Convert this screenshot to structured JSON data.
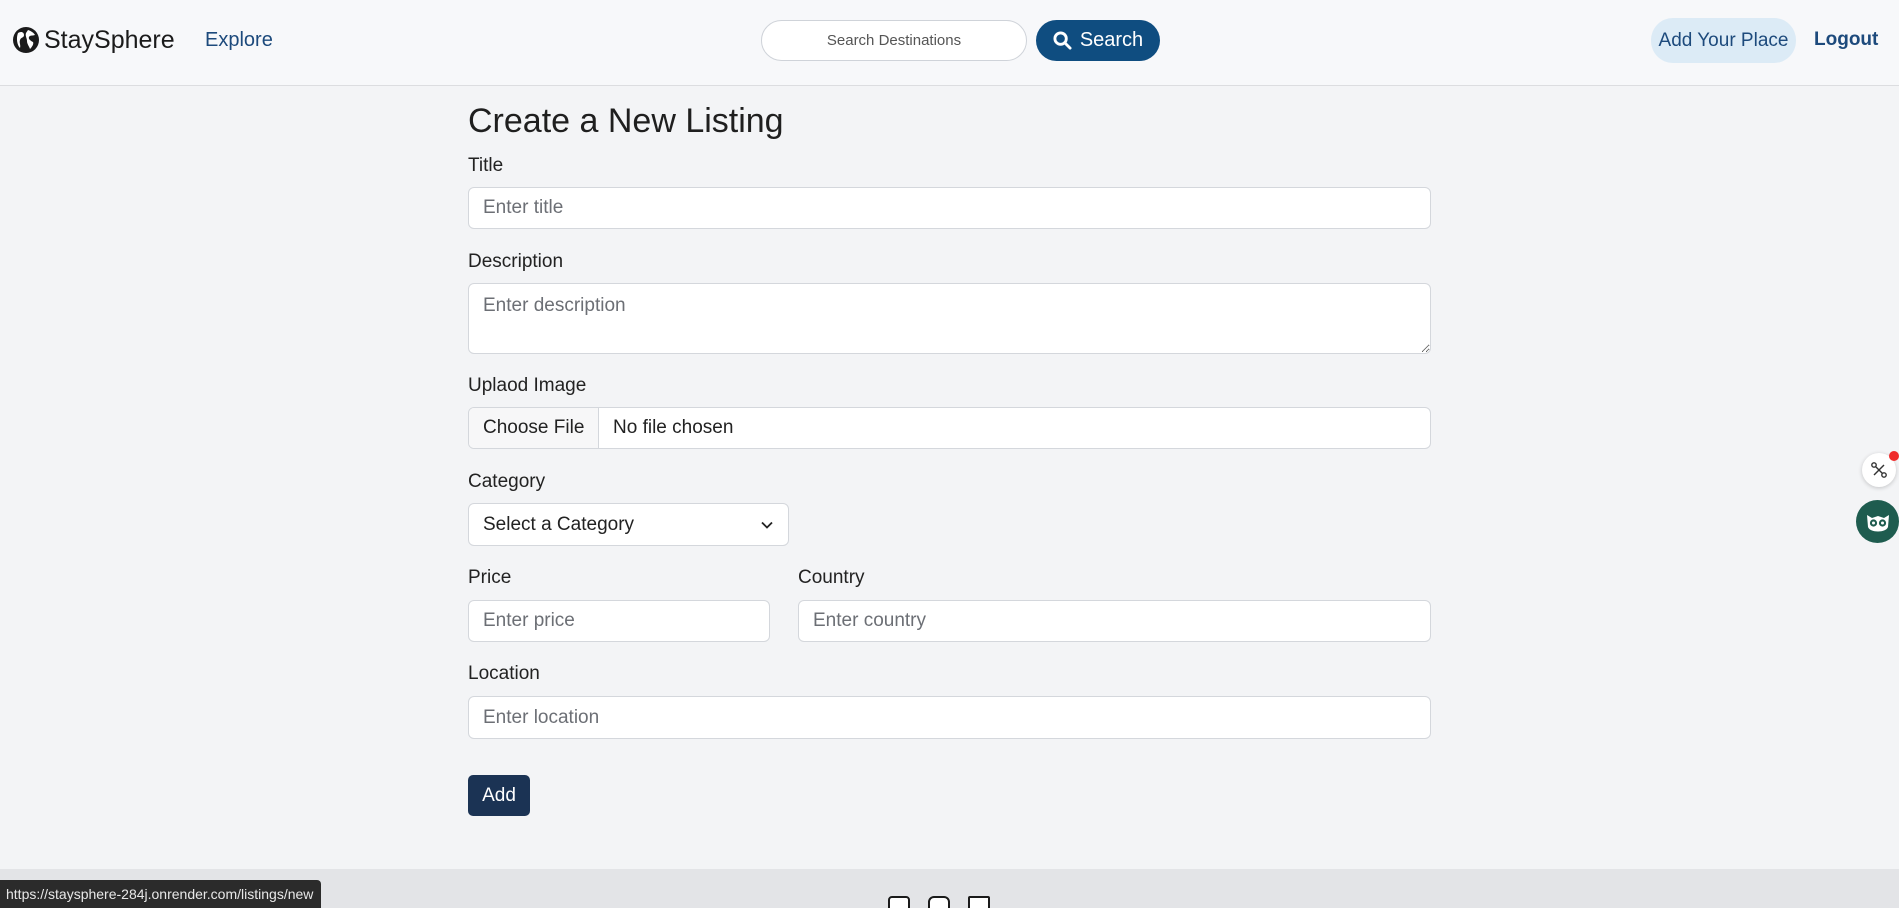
{
  "navbar": {
    "brand_name": "StaySphere",
    "brand_icon": "globe-icon",
    "explore_label": "Explore",
    "search_placeholder": "Search Destinations",
    "search_button_label": "Search",
    "search_icon": "search-icon",
    "add_place_label": "Add Your Place",
    "logout_label": "Logout"
  },
  "form": {
    "title": "Create a New Listing",
    "title_label": "Title",
    "title_placeholder": "Enter title",
    "description_label": "Description",
    "description_placeholder": "Enter description",
    "image_label": "Uplaod Image",
    "file_button_label": "Choose File",
    "file_status": "No file chosen",
    "category_label": "Category",
    "category_selected": "Select a Category",
    "price_label": "Price",
    "price_placeholder": "Enter price",
    "country_label": "Country",
    "country_placeholder": "Enter country",
    "location_label": "Location",
    "location_placeholder": "Enter location",
    "submit_label": "Add"
  },
  "footer": {
    "social_icons": [
      "facebook-icon",
      "instagram-icon",
      "x-icon"
    ]
  },
  "status_bar": {
    "url": "https://staysphere-284j.onrender.com/listings/new"
  },
  "floating_widgets": {
    "share_icon": "share-icon",
    "assistant_icon": "owl-icon",
    "notification_color": "#ef2b2b"
  },
  "colors": {
    "primary": "#0f4d80",
    "link": "#1d4a7c",
    "submit": "#1b3354",
    "page_background": "#f3f4f6",
    "add_place_background": "#dcebf6"
  }
}
